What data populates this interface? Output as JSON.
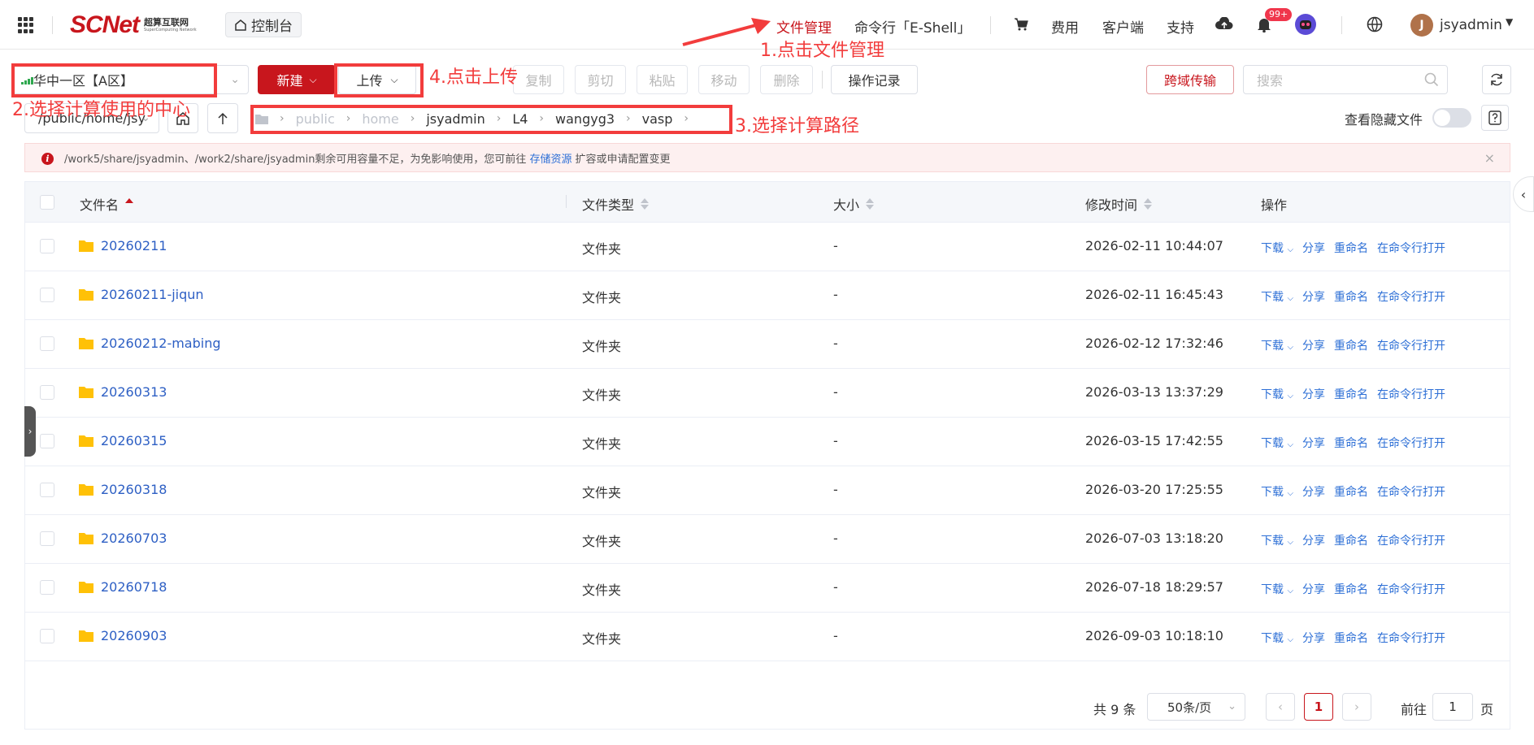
{
  "nav": {
    "logo_main": "SCNet",
    "logo_cn": "超算互联网",
    "logo_en": "SuperComputing Network",
    "console_label": "控制台",
    "links": [
      {
        "label": "文件管理",
        "active": true
      },
      {
        "label": "命令行「E-Shell」",
        "active": false
      },
      {
        "label": "费用",
        "active": false
      },
      {
        "label": "客户端",
        "active": false
      },
      {
        "label": "支持",
        "active": false
      }
    ],
    "notif_badge": "99+",
    "avatar_letter": "J",
    "username": "jsyadmin"
  },
  "toolbar": {
    "region": "华中一区【A区】",
    "new_label": "新建",
    "upload_label": "上传",
    "copy_label": "复制",
    "cut_label": "剪切",
    "paste_label": "粘贴",
    "move_label": "移动",
    "delete_label": "删除",
    "history_label": "操作记录",
    "cross_region_label": "跨域传输",
    "search_placeholder": "搜索"
  },
  "pathbar": {
    "path_value": "/public/home/jsy",
    "crumbs": [
      "public",
      "home",
      "jsyadmin",
      "L4",
      "wangyg3",
      "vasp"
    ],
    "hidden_files_label": "查看隐藏文件"
  },
  "warning": {
    "text_before": "/work5/share/jsyadmin、/work2/share/jsyadmin剩余可用容量不足，为免影响使用，您可前往",
    "link": "存储资源",
    "text_after": "扩容或申请配置变更"
  },
  "table": {
    "headers": {
      "name": "文件名",
      "type": "文件类型",
      "size": "大小",
      "mtime": "修改时间",
      "ops": "操作"
    },
    "op_labels": {
      "download": "下载",
      "share": "分享",
      "rename": "重命名",
      "open_cli": "在命令行打开"
    },
    "rows": [
      {
        "name": "20260211",
        "type": "文件夹",
        "size": "-",
        "mtime": "2026-02-11 10:44:07"
      },
      {
        "name": "20260211-jiqun",
        "type": "文件夹",
        "size": "-",
        "mtime": "2026-02-11 16:45:43"
      },
      {
        "name": "20260212-mabing",
        "type": "文件夹",
        "size": "-",
        "mtime": "2026-02-12 17:32:46"
      },
      {
        "name": "20260313",
        "type": "文件夹",
        "size": "-",
        "mtime": "2026-03-13 13:37:29"
      },
      {
        "name": "20260315",
        "type": "文件夹",
        "size": "-",
        "mtime": "2026-03-15 17:42:55"
      },
      {
        "name": "20260318",
        "type": "文件夹",
        "size": "-",
        "mtime": "2026-03-20 17:25:55"
      },
      {
        "name": "20260703",
        "type": "文件夹",
        "size": "-",
        "mtime": "2026-07-03 13:18:20"
      },
      {
        "name": "20260718",
        "type": "文件夹",
        "size": "-",
        "mtime": "2026-07-18 18:29:57"
      },
      {
        "name": "20260903",
        "type": "文件夹",
        "size": "-",
        "mtime": "2026-09-03 10:18:10"
      }
    ]
  },
  "pagination": {
    "total": "共 9 条",
    "page_size": "50条/页",
    "current_page": "1",
    "goto_label": "前往",
    "goto_value": "1",
    "goto_suffix": "页"
  },
  "annotations": {
    "step1": "1.点击文件管理",
    "step2": "2.选择计算使用的中心",
    "step3": "3.选择计算路径",
    "step4": "4.点击上传"
  },
  "colors": {
    "brand": "#c8161d",
    "link": "#2d6fd6",
    "annotation": "#f23c3c",
    "folder": "#ffc107"
  }
}
